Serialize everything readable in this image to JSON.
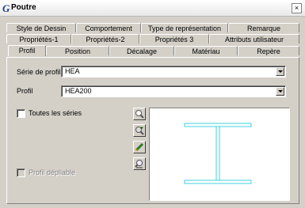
{
  "window": {
    "title": "Poutre",
    "title_icon": "G",
    "close": "×"
  },
  "tabs_row1": [
    "Style de Dessin",
    "Comportement",
    "Type de représentation",
    "Remarque"
  ],
  "tabs_row2": [
    "Propriétés-1",
    "Propriétés-2",
    "Propriétés 3",
    "Attributs utilisateur"
  ],
  "tabs_row3": [
    "Profil",
    "Position",
    "Décalage",
    "Matériau",
    "Repère"
  ],
  "active_tab": "Profil",
  "serie": {
    "label": "Série de profil",
    "value": "HEA"
  },
  "profil": {
    "label": "Profil",
    "value": "HEA200"
  },
  "toutes_series": {
    "label": "Toutes les séries",
    "checked": false
  },
  "profil_depliable": {
    "label": "Profil dépliable",
    "checked": false,
    "enabled": false
  },
  "tool_icons": [
    "zoom-icon",
    "zoom-in-icon",
    "pencil-icon",
    "measure-icon"
  ],
  "colors": {
    "profile_stroke": "#3fd0e0"
  }
}
